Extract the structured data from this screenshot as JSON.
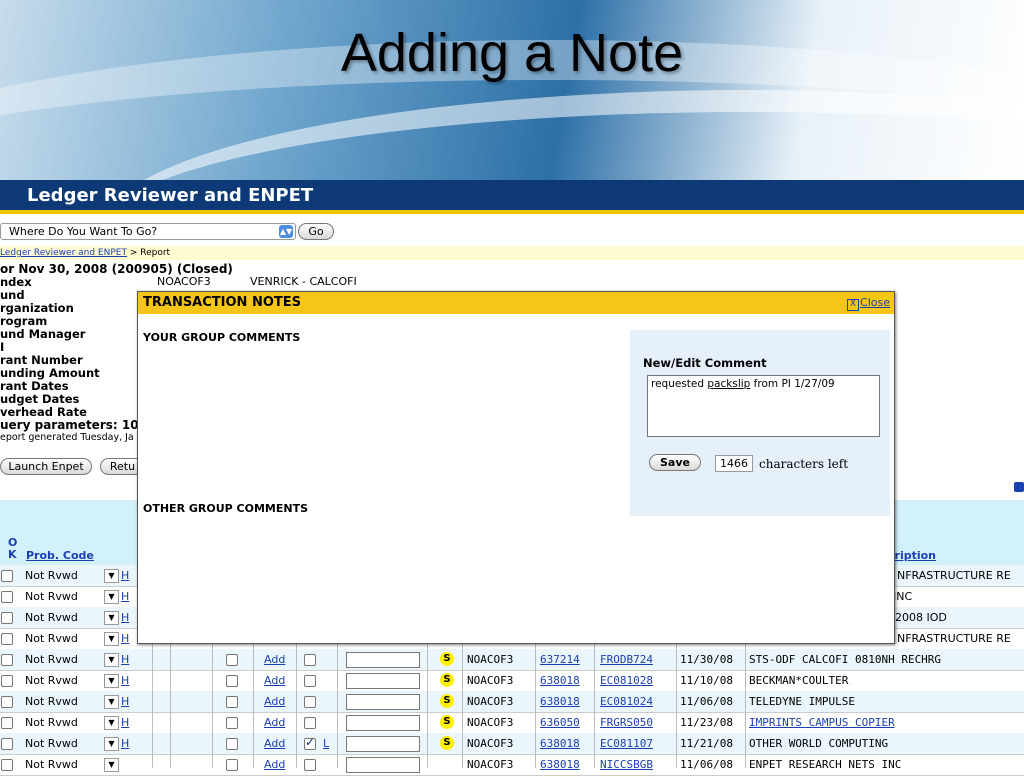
{
  "slide": {
    "title": "Adding a Note"
  },
  "app": {
    "title": "Ledger Reviewer and ENPET"
  },
  "nav": {
    "select_value": "Where Do You Want To Go?",
    "go_label": "Go"
  },
  "breadcrumb": {
    "link": "Ledger Reviewer and ENPET",
    "separator": " > ",
    "current": "Report"
  },
  "report": {
    "heading": "or Nov 30, 2008 (200905) (Closed)",
    "labels": [
      "ndex",
      "und",
      "rganization",
      "rogram",
      "und Manager",
      "I",
      "rant Number",
      "unding Amount",
      "rant Dates",
      "udget Dates",
      "verhead Rate"
    ],
    "index_value": "NOACOF3",
    "index_name": "VENRICK - CALCOFI",
    "query_params": "uery parameters: 10",
    "generated": "eport generated Tuesday, Ja"
  },
  "buttons": {
    "launch_enpet": "Launch Enpet",
    "return": "Retu"
  },
  "table": {
    "headers": {
      "ok": "O K",
      "prob_code": "Prob. Code",
      "description": "cription"
    },
    "rows_covered": [
      {
        "status": "Not Rvwd",
        "h": "H",
        "description": "NFRASTRUCTURE RE"
      },
      {
        "status": "Not Rvwd",
        "h": "H",
        "description": " INC"
      },
      {
        "status": "Not Rvwd",
        "h": "H",
        "description": "2008 IOD"
      },
      {
        "status": "Not Rvwd",
        "h": "H",
        "description": "NFRASTRUCTURE RE"
      }
    ],
    "rows": [
      {
        "status": "Not Rvwd",
        "h": "H",
        "add": "Add",
        "checked": false,
        "flag": "",
        "s": "S",
        "index": "NOACOF3",
        "account": "637214",
        "doc": "FRODB724",
        "date": "11/30/08",
        "description": "STS-ODF CALCOFI 0810NH RECHRG",
        "desc_link": false
      },
      {
        "status": "Not Rvwd",
        "h": "H",
        "add": "Add",
        "checked": false,
        "flag": "",
        "s": "S",
        "index": "NOACOF3",
        "account": "638018",
        "doc": "EC081028",
        "date": "11/10/08",
        "description": "BECKMAN*COULTER",
        "desc_link": false
      },
      {
        "status": "Not Rvwd",
        "h": "H",
        "add": "Add",
        "checked": false,
        "flag": "",
        "s": "S",
        "index": "NOACOF3",
        "account": "638018",
        "doc": "EC081024",
        "date": "11/06/08",
        "description": "TELEDYNE IMPULSE",
        "desc_link": false
      },
      {
        "status": "Not Rvwd",
        "h": "H",
        "add": "Add",
        "checked": false,
        "flag": "",
        "s": "S",
        "index": "NOACOF3",
        "account": "636050",
        "doc": "FRGRS050",
        "date": "11/23/08",
        "description": "IMPRINTS CAMPUS COPIER",
        "desc_link": true
      },
      {
        "status": "Not Rvwd",
        "h": "H",
        "add": "Add",
        "checked": true,
        "flag": "L",
        "s": "S",
        "index": "NOACOF3",
        "account": "638018",
        "doc": "EC081107",
        "date": "11/21/08",
        "description": "OTHER WORLD COMPUTING",
        "desc_link": false
      },
      {
        "status": "Not Rvwd",
        "h": "",
        "add": "Add",
        "checked": false,
        "flag": "",
        "s": "",
        "index": "NOACOF3",
        "account": "638018",
        "doc": "NICCSBGB",
        "date": "11/06/08",
        "description": "ENPET RESEARCH NETS INC",
        "desc_link": false
      }
    ]
  },
  "modal": {
    "title": "TRANSACTION NOTES",
    "close_label": "Close",
    "close_x": "X",
    "your_group": "YOUR GROUP COMMENTS",
    "other_group": "OTHER GROUP COMMENTS",
    "edit_heading": "New/Edit Comment",
    "comment_pre": "requested ",
    "comment_underlined": "packslip",
    "comment_post": " from PI 1/27/09",
    "save_label": "Save",
    "chars_left_value": "1466",
    "chars_left_label": "characters left"
  }
}
